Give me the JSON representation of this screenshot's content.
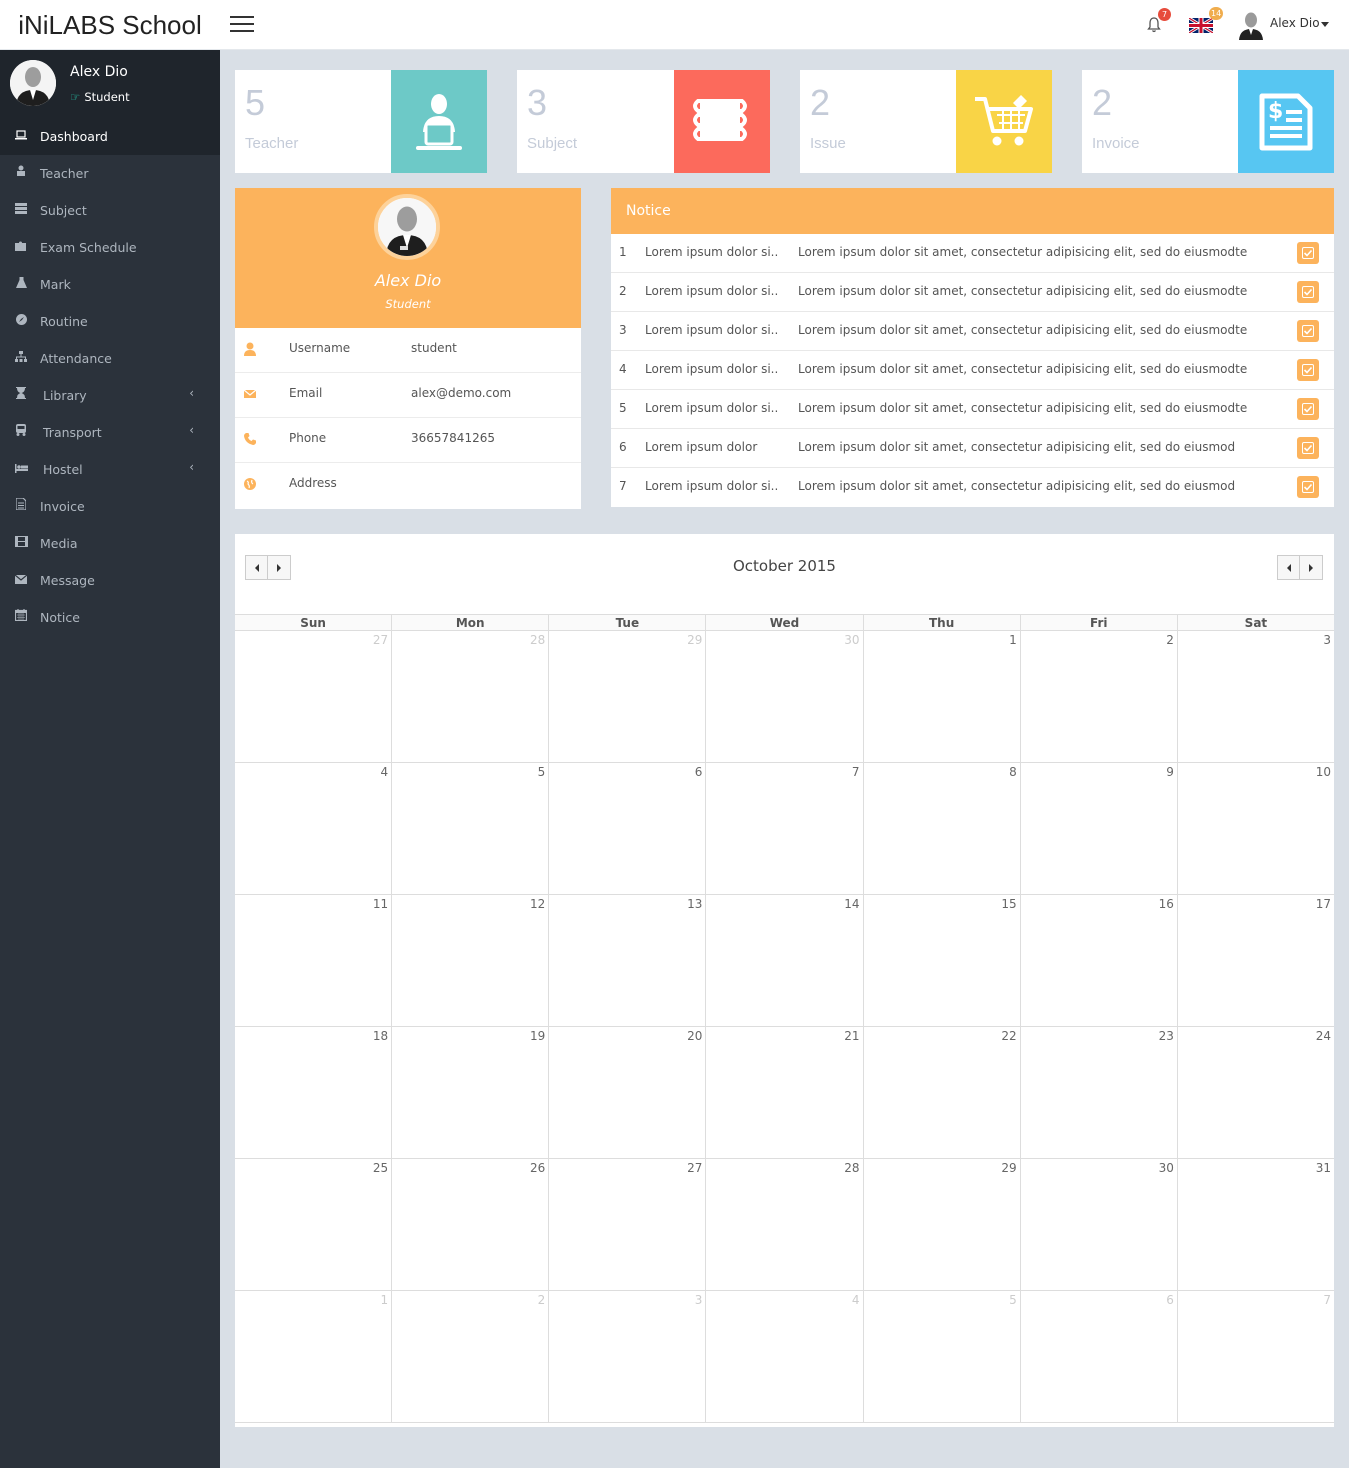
{
  "header": {
    "brand": "iNiLABS School",
    "notification_count": "7",
    "language_badge": "14",
    "user_name": "Alex Dio"
  },
  "sidebar": {
    "user_name": "Alex Dio",
    "user_role": "Student",
    "items": [
      {
        "label": "Dashboard",
        "icon": "laptop-icon",
        "active": true
      },
      {
        "label": "Teacher",
        "icon": "teacher-icon"
      },
      {
        "label": "Subject",
        "icon": "book-icon"
      },
      {
        "label": "Exam Schedule",
        "icon": "puzzle-icon"
      },
      {
        "label": "Mark",
        "icon": "flask-icon"
      },
      {
        "label": "Routine",
        "icon": "compass-icon"
      },
      {
        "label": "Attendance",
        "icon": "sitemap-icon"
      },
      {
        "label": "Library",
        "icon": "hourglass-icon",
        "has_submenu": true
      },
      {
        "label": "Transport",
        "icon": "bus-icon",
        "has_submenu": true
      },
      {
        "label": "Hostel",
        "icon": "bed-icon",
        "has_submenu": true
      },
      {
        "label": "Invoice",
        "icon": "invoice-icon"
      },
      {
        "label": "Media",
        "icon": "film-icon"
      },
      {
        "label": "Message",
        "icon": "envelope-icon"
      },
      {
        "label": "Notice",
        "icon": "calendar-icon"
      }
    ]
  },
  "stats": [
    {
      "count": "5",
      "label": "Teacher",
      "color": "#6dc9c7",
      "icon": "teacher-laptop-icon"
    },
    {
      "count": "3",
      "label": "Subject",
      "color": "#fc6a5c",
      "icon": "books-icon"
    },
    {
      "count": "2",
      "label": "Issue",
      "color": "#f9d446",
      "icon": "cart-icon"
    },
    {
      "count": "2",
      "label": "Invoice",
      "color": "#57c6f2",
      "icon": "invoice-dollar-icon"
    }
  ],
  "profile": {
    "name": "Alex Dio",
    "role": "Student",
    "rows": [
      {
        "key": "Username",
        "value": "student",
        "icon": "user-icon"
      },
      {
        "key": "Email",
        "value": "alex@demo.com",
        "icon": "envelope-icon"
      },
      {
        "key": "Phone",
        "value": "36657841265",
        "icon": "phone-icon"
      },
      {
        "key": "Address",
        "value": "",
        "icon": "globe-icon"
      }
    ]
  },
  "notice": {
    "title": "Notice",
    "rows": [
      {
        "index": "1",
        "title": "Lorem ipsum dolor si..",
        "notice": "Lorem ipsum dolor sit amet, consectetur adipisicing elit, sed do eiusmodtemp.."
      },
      {
        "index": "2",
        "title": "Lorem ipsum dolor si..",
        "notice": "Lorem ipsum dolor sit amet, consectetur adipisicing elit, sed do eiusmodtemp.."
      },
      {
        "index": "3",
        "title": "Lorem ipsum dolor si..",
        "notice": "Lorem ipsum dolor sit amet, consectetur adipisicing elit, sed do eiusmodtemp.."
      },
      {
        "index": "4",
        "title": "Lorem ipsum dolor si..",
        "notice": "Lorem ipsum dolor sit amet, consectetur adipisicing elit, sed do eiusmodtemp.."
      },
      {
        "index": "5",
        "title": "Lorem ipsum dolor si..",
        "notice": "Lorem ipsum dolor sit amet, consectetur adipisicing elit, sed do eiusmodtemp.."
      },
      {
        "index": "6",
        "title": "Lorem ipsum dolor",
        "notice": "Lorem ipsum dolor sit amet, consectetur adipisicing elit, sed do eiusmod"
      },
      {
        "index": "7",
        "title": "Lorem ipsum dolor si..",
        "notice": "Lorem ipsum dolor sit amet, consectetur adipisicing elit, sed do eiusmod"
      }
    ]
  },
  "calendar": {
    "title": "October 2015",
    "days_of_week": [
      "Sun",
      "Mon",
      "Tue",
      "Wed",
      "Thu",
      "Fri",
      "Sat"
    ],
    "weeks": [
      [
        {
          "d": "27",
          "other": true
        },
        {
          "d": "28",
          "other": true
        },
        {
          "d": "29",
          "other": true
        },
        {
          "d": "30",
          "other": true
        },
        {
          "d": "1"
        },
        {
          "d": "2"
        },
        {
          "d": "3"
        }
      ],
      [
        {
          "d": "4"
        },
        {
          "d": "5"
        },
        {
          "d": "6"
        },
        {
          "d": "7"
        },
        {
          "d": "8"
        },
        {
          "d": "9"
        },
        {
          "d": "10"
        }
      ],
      [
        {
          "d": "11"
        },
        {
          "d": "12"
        },
        {
          "d": "13"
        },
        {
          "d": "14"
        },
        {
          "d": "15"
        },
        {
          "d": "16"
        },
        {
          "d": "17"
        }
      ],
      [
        {
          "d": "18"
        },
        {
          "d": "19"
        },
        {
          "d": "20"
        },
        {
          "d": "21"
        },
        {
          "d": "22"
        },
        {
          "d": "23"
        },
        {
          "d": "24"
        }
      ],
      [
        {
          "d": "25"
        },
        {
          "d": "26"
        },
        {
          "d": "27"
        },
        {
          "d": "28"
        },
        {
          "d": "29"
        },
        {
          "d": "30"
        },
        {
          "d": "31"
        }
      ],
      [
        {
          "d": "1",
          "other": true
        },
        {
          "d": "2",
          "other": true
        },
        {
          "d": "3",
          "other": true
        },
        {
          "d": "4",
          "other": true
        },
        {
          "d": "5",
          "other": true
        },
        {
          "d": "6",
          "other": true
        },
        {
          "d": "7",
          "other": true
        }
      ]
    ]
  },
  "colors": {
    "accent_orange": "#fcb35c",
    "sidebar_bg": "#2b323b",
    "page_bg": "#d9dfe6"
  }
}
